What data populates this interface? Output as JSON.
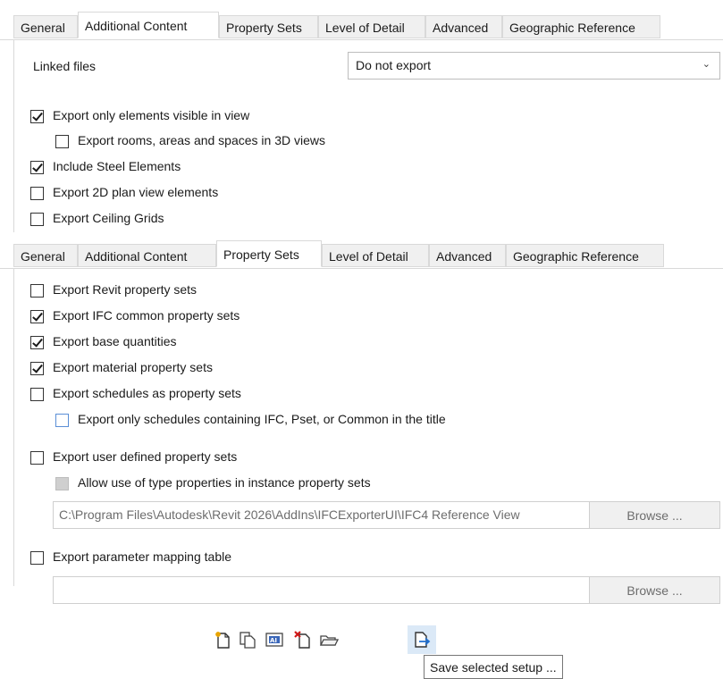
{
  "panel1": {
    "tabs": [
      "General",
      "Additional Content",
      "Property Sets",
      "Level of Detail",
      "Advanced",
      "Geographic Reference"
    ],
    "active_tab": "Additional Content",
    "linked_files_label": "Linked files",
    "linked_files_value": "Do not export",
    "options": [
      {
        "label": "Export only elements visible in view",
        "checked": true
      },
      {
        "label": "Export rooms, areas and spaces in 3D views",
        "checked": false
      },
      {
        "label": "Include Steel Elements",
        "checked": true
      },
      {
        "label": "Export 2D plan view elements",
        "checked": false
      },
      {
        "label": "Export Ceiling Grids",
        "checked": false
      }
    ]
  },
  "panel2": {
    "tabs": [
      "General",
      "Additional Content",
      "Property Sets",
      "Level of Detail",
      "Advanced",
      "Geographic Reference"
    ],
    "active_tab": "Property Sets",
    "options": [
      {
        "label": "Export Revit property sets",
        "checked": false
      },
      {
        "label": "Export IFC common property sets",
        "checked": true
      },
      {
        "label": "Export base quantities",
        "checked": true
      },
      {
        "label": "Export material property sets",
        "checked": true
      },
      {
        "label": "Export schedules as property sets",
        "checked": false
      },
      {
        "label": "Export only schedules containing IFC, Pset, or Common in the title",
        "checked": false
      },
      {
        "label": "Export user defined property sets",
        "checked": false
      },
      {
        "label": "Allow use of type properties in instance property sets",
        "checked": false
      },
      {
        "label": "Export parameter mapping table",
        "checked": false
      }
    ],
    "user_defined_path": "C:\\Program Files\\Autodesk\\Revit 2026\\AddIns\\IFCExporterUI\\IFC4 Reference View",
    "mapping_path": "",
    "browse_label": "Browse ..."
  },
  "toolbar": {
    "icons": [
      "new-setup-icon",
      "duplicate-setup-icon",
      "rename-setup-icon",
      "delete-setup-icon",
      "load-setup-icon",
      "save-setup-icon"
    ],
    "tooltip": "Save selected setup ..."
  }
}
